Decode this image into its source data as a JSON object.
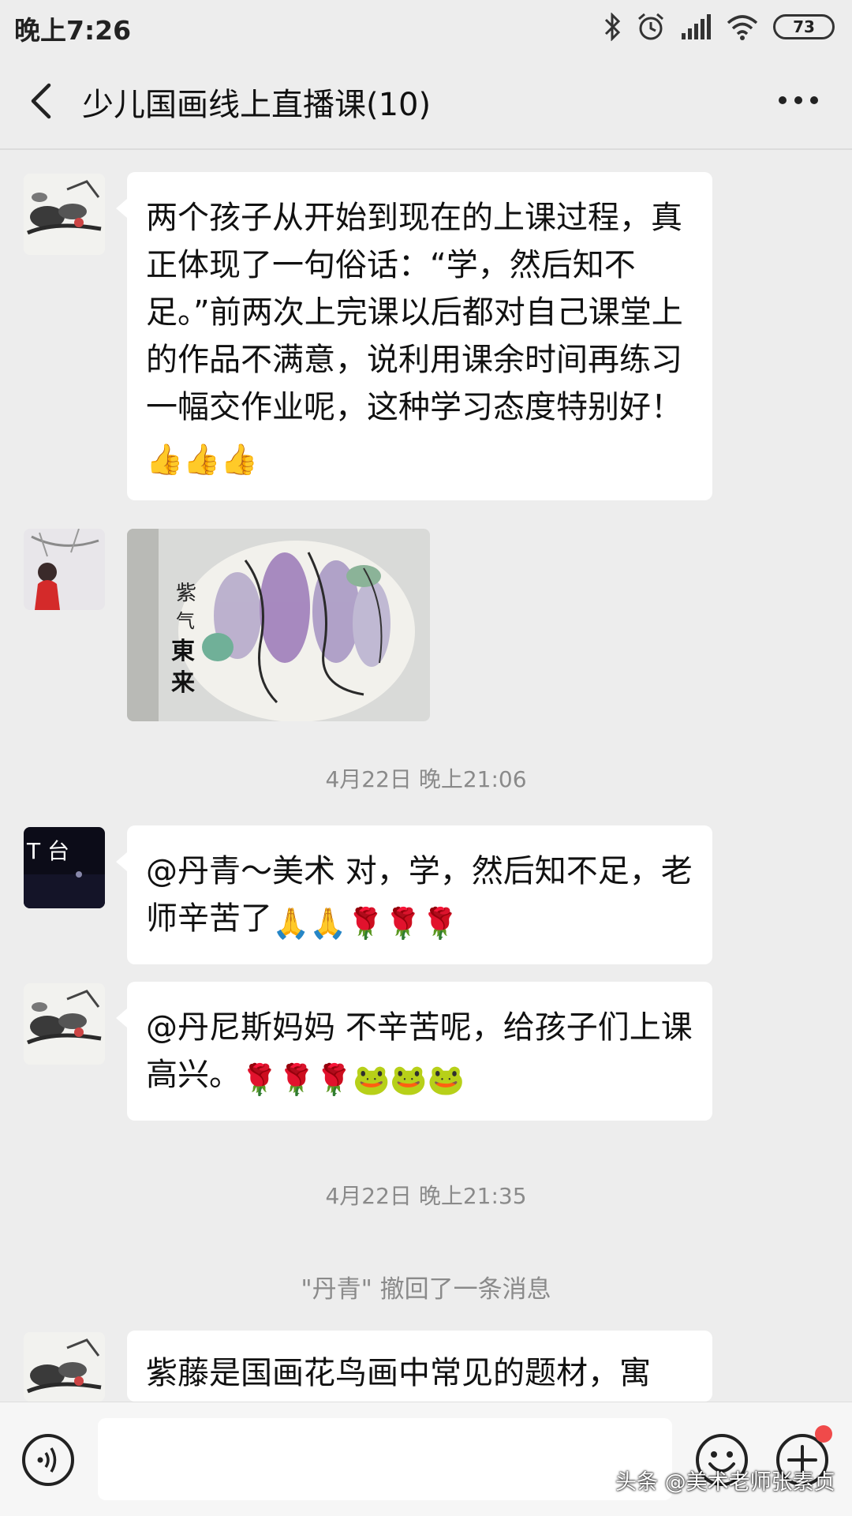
{
  "status_bar": {
    "time": "晚上7:26",
    "battery": "73"
  },
  "header": {
    "title": "少儿国画线上直播课(10)"
  },
  "messages": [
    {
      "text": "两个孩子从开始到现在的上课过程，真正体现了一句俗话：“学，然后知不足。”前两次上完课以后都对自己课堂上的作品不满意，说利用课余时间再练习一幅交作业呢，这种学习态度特别好！",
      "emoji": "👍👍👍"
    },
    {
      "text": "@丹青～美术  对，学，然后知不足，老师辛苦了",
      "emoji": "🙏🙏🌹🌹🌹"
    },
    {
      "text": "@丹尼斯妈妈  不辛苦呢，给孩子们上课高兴。",
      "emoji": "🌹🌹🌹🐸🐸🐸"
    },
    {
      "text": "紫藤是国画花鸟画中常见的题材，寓"
    }
  ],
  "painting": {
    "inscription": "紫气東来"
  },
  "timestamps": [
    "4月22日 晚上21:06",
    "4月22日 晚上21:35"
  ],
  "system_note": "\"丹青\" 撤回了一条消息",
  "avatar_label": "T 台",
  "watermark": "头条 @美术老师张素贞"
}
